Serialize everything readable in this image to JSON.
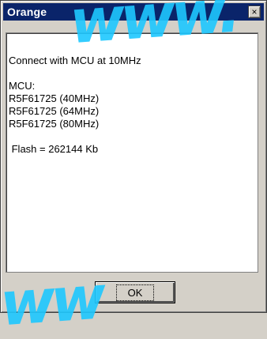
{
  "window": {
    "title": "Orange",
    "close_glyph": "×"
  },
  "message": {
    "lines": [
      "Connect with MCU at 10MHz",
      "",
      "MCU:",
      "R5F61725 (40MHz)",
      "R5F61725 (64MHz)",
      "R5F61725 (80MHz)",
      "",
      " Flash = 262144 Kb"
    ]
  },
  "buttons": {
    "ok_label": "OK"
  },
  "watermark": {
    "top_text": "www.",
    "bottom_text": "ww",
    "color": "#1ec8ff"
  },
  "colors": {
    "titlebar": "#0a246a",
    "face": "#d4d0c8"
  }
}
